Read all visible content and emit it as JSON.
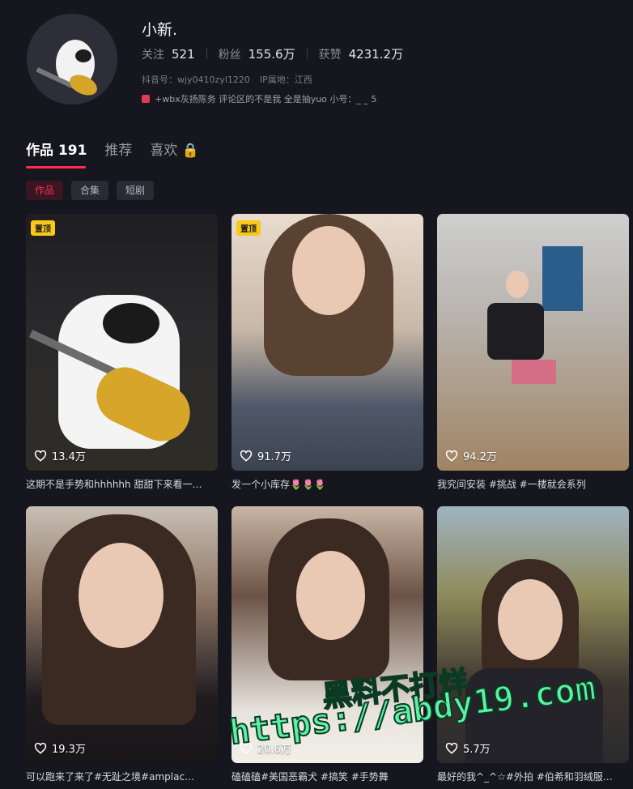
{
  "profile": {
    "username": "小新.",
    "stats": [
      {
        "label": "关注",
        "value": "521"
      },
      {
        "label": "粉丝",
        "value": "155.6万"
      },
      {
        "label": "获赞",
        "value": "4231.2万"
      }
    ],
    "account_id": "抖音号：wjy0410zyl1220",
    "ip_location": "IP属地：江西",
    "bio": "+wbx灰扬陈务 评论区的不是我 全是抽yuo 小号：_ _ 5"
  },
  "tabs": [
    {
      "label": "作品 191",
      "active": true
    },
    {
      "label": "推荐",
      "active": false
    },
    {
      "label": "喜欢 🔒",
      "active": false
    }
  ],
  "chips": [
    {
      "label": "作品",
      "active": true
    },
    {
      "label": "合集",
      "active": false
    },
    {
      "label": "短剧",
      "active": false
    }
  ],
  "videos": [
    {
      "pinned": "置顶",
      "likes": "13.4万",
      "caption": "这期不是手势和hhhhhh 甜甜下来看一…"
    },
    {
      "pinned": "置顶",
      "likes": "91.7万",
      "caption": "发一个小库存🌷🌷🌷"
    },
    {
      "pinned": "",
      "likes": "94.2万",
      "caption": "我究间安装 #挑战 #一楼就会系列"
    },
    {
      "pinned": "",
      "likes": "19.3万",
      "caption": "可以跑来了来了#无趾之境#amplac…"
    },
    {
      "pinned": "",
      "likes": "20.6万",
      "caption": "磕磕磕#美国恶霸犬 #搞笑 #手势舞"
    },
    {
      "pinned": "",
      "likes": "5.7万",
      "caption": "最好的我^_^☆#外拍 #伯希和羽绒服…"
    }
  ],
  "watermark": {
    "line1": "黑料不打烊",
    "line2": "https://abdy19.com"
  },
  "colors": {
    "background": "#16161e",
    "accent": "#fe2c55",
    "pin_badge": "#f9c81a",
    "watermark": "#5af2a4"
  },
  "icons": {
    "like": "heart-outline-icon",
    "lock": "lock-icon"
  }
}
